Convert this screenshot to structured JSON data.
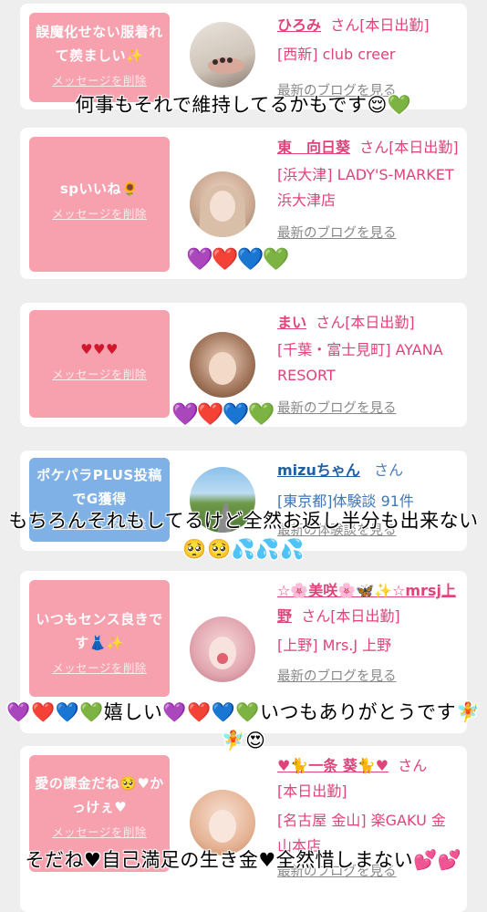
{
  "cards": [
    {
      "message": "誤魔化せない服着れて羨ましい✨",
      "delete_label": "メッセージを削除",
      "name": "ひろみ",
      "san": "さん[本日出勤]",
      "shop": "[西新] club creer",
      "blog_link": "最新のブログを見る"
    },
    {
      "message": "spいいね🌻",
      "delete_label": "メッセージを削除",
      "name": "東　向日葵",
      "san": "さん[本日出勤]",
      "shop": "[浜大津] LADY'S-MARKET 浜大津店",
      "blog_link": "最新のブログを見る"
    },
    {
      "message": "♥♥♥",
      "delete_label": "メッセージを削除",
      "name": "まい",
      "san": "さん[本日出勤]",
      "shop": "[千葉・富士見町] AYANA RESORT",
      "blog_link": "最新のブログを見る"
    },
    {
      "message": "ポケパラPLUS投稿でG獲得",
      "delete_label": "メッセージを削除",
      "name": "mizuちゃん",
      "san": "さん",
      "shop": "[東京都]体験談 91件",
      "blog_link": "最新の体験談を見る"
    },
    {
      "message": "いつもセンス良きです👗✨",
      "delete_label": "メッセージを削除",
      "name": "☆🌸美咲🌸🦋✨☆mrsj上野",
      "san": "さん[本日出勤]",
      "shop": "[上野] Mrs.J 上野",
      "blog_link": "最新のブログを見る"
    },
    {
      "message": "愛の課金だね🥺♥かっけぇ♥",
      "delete_label": "メッセージを削除",
      "name": "♥🐈一条 葵🐈♥",
      "san": "さん",
      "extra": "[本日出勤]",
      "shop": "[名古屋 金山] 楽GAKU 金山本店",
      "blog_link": "最新のブログを見る"
    }
  ],
  "overlays": [
    "何事もそれで維持してるかもです😌💚",
    "💜❤️💙💚",
    "💜❤️💙💚",
    "もちろんそれもしてるけど全然お返し半分も出来ない🥺🥺💦💦💦",
    "💜❤️💙💚嬉しい💜❤️💙💚いつもありがとうです🧚🧚😍",
    "そだね♥自己満足の生き金♥全然惜しまない💕💕"
  ],
  "colors": {
    "background": "#eeeeee",
    "bubble_pink": "#f7a1ae",
    "bubble_blue": "#7fb1e6",
    "name_pink": "#e0437a",
    "name_blue": "#1f5fa3"
  }
}
